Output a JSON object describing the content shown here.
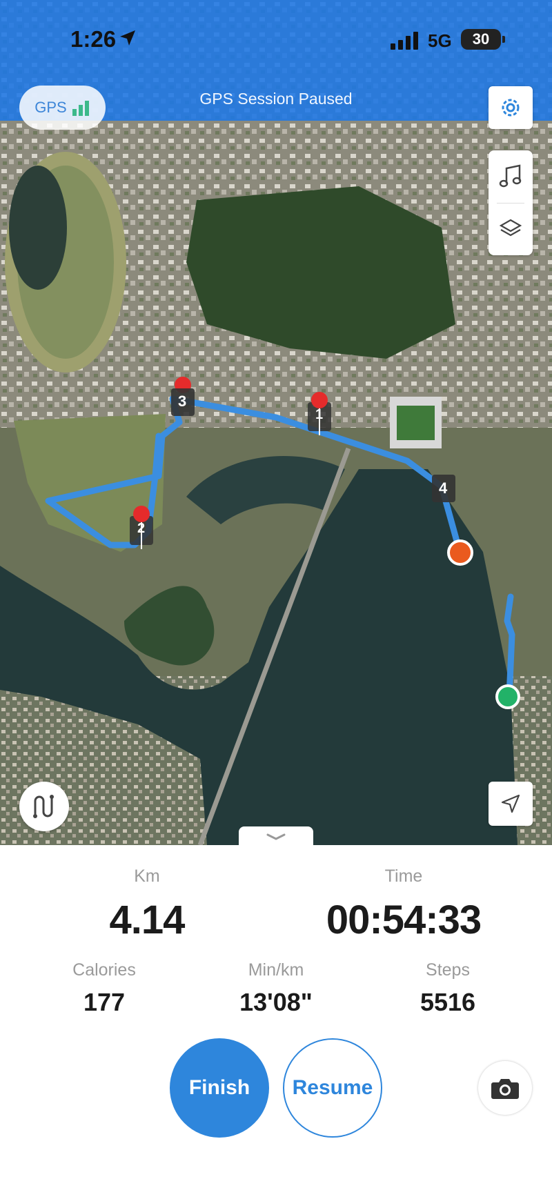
{
  "status_bar": {
    "time": "1:26",
    "network": "5G",
    "battery": "30"
  },
  "top": {
    "gps_label": "GPS",
    "session_status": "GPS Session Paused"
  },
  "map": {
    "markers": [
      {
        "label": "1"
      },
      {
        "label": "2"
      },
      {
        "label": "3"
      },
      {
        "label": "4"
      }
    ]
  },
  "stats": {
    "distance": {
      "label": "Km",
      "value": "4.14"
    },
    "time": {
      "label": "Time",
      "value": "00:54:33"
    },
    "calories": {
      "label": "Calories",
      "value": "177"
    },
    "pace": {
      "label": "Min/km",
      "value": "13'08\""
    },
    "steps": {
      "label": "Steps",
      "value": "5516"
    }
  },
  "actions": {
    "finish": "Finish",
    "resume": "Resume"
  },
  "colors": {
    "accent": "#2e86dc",
    "route": "#3b8ee0",
    "end_marker": "#ea5a1e",
    "start_marker": "#22b268"
  }
}
